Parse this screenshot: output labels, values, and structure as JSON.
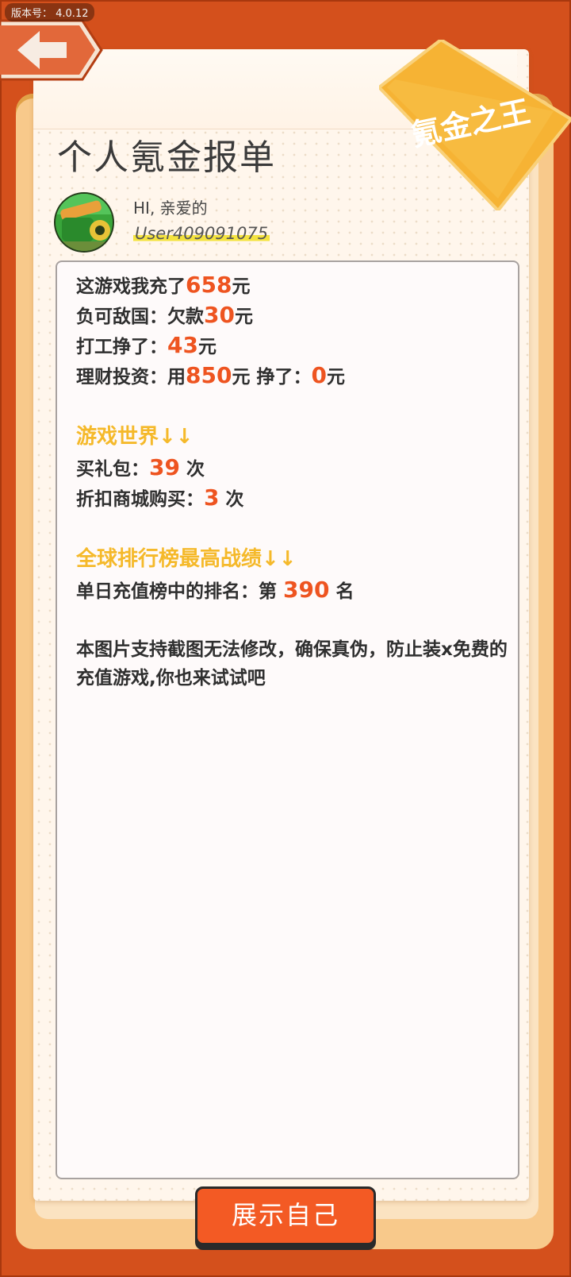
{
  "version_label": "版本号： 4.0.12",
  "badge_text": "氪金之王",
  "title": "个人氪金报单",
  "greeting": "HI, 亲爱的",
  "username": "User409091075",
  "lines": {
    "recharge_prefix": "这游戏我充了",
    "recharge_value": "658",
    "recharge_unit": "元",
    "debt_prefix": "负可敌国：欠款",
    "debt_value": "30",
    "debt_unit": "元",
    "work_prefix": "打工挣了：",
    "work_value": "43",
    "work_unit": "元",
    "invest_prefix": "理财投资：用",
    "invest_value": "850",
    "invest_mid": "元 挣了：",
    "invest_earn": "0",
    "invest_unit": "元"
  },
  "game_world": {
    "heading": "游戏世界↓↓",
    "gift_prefix": "买礼包：",
    "gift_value": "39",
    "gift_unit": "次",
    "discount_prefix": "折扣商城购买：",
    "discount_value": "3",
    "discount_unit": "次"
  },
  "ranking": {
    "heading": "全球排行榜最高战绩↓↓",
    "rank_prefix": "单日充值榜中的排名：第",
    "rank_value": "390",
    "rank_unit": "名"
  },
  "note": "本图片支持截图无法修改，确保真伪，防止装x免费的充值游戏,你也来试试吧",
  "show_button": "展示自己",
  "colors": {
    "background": "#d4501c",
    "accent": "#ee5420",
    "heading": "#f5b92a",
    "badge": "#f7b733"
  }
}
